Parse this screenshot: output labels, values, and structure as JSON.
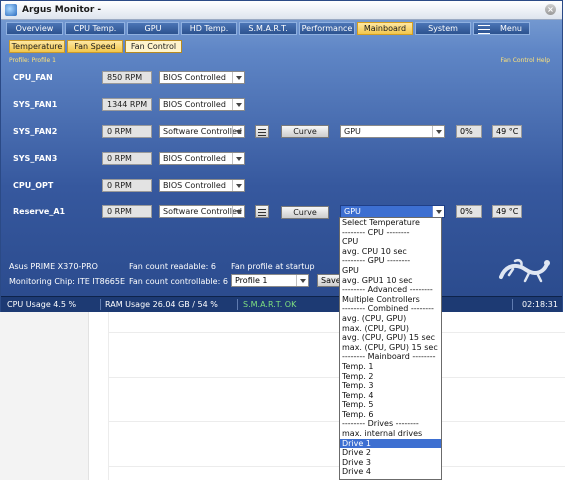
{
  "window": {
    "title": "Argus Monitor -"
  },
  "tabs": [
    {
      "label": "Overview",
      "active": false
    },
    {
      "label": "CPU Temp.",
      "active": false
    },
    {
      "label": "GPU",
      "active": false
    },
    {
      "label": "HD Temp.",
      "active": false
    },
    {
      "label": "S.M.A.R.T.",
      "active": false
    },
    {
      "label": "Performance",
      "active": false
    },
    {
      "label": "Mainboard",
      "active": true
    },
    {
      "label": "System",
      "active": false
    },
    {
      "label": "Menu",
      "active": false
    }
  ],
  "subtabs": [
    {
      "label": "Temperature",
      "active": false
    },
    {
      "label": "Fan Speed",
      "active": false
    },
    {
      "label": "Fan Control",
      "active": true
    }
  ],
  "profile_label": "Profile: Profile 1",
  "help_link": "Fan Control Help",
  "fans": [
    {
      "name": "CPU_FAN",
      "rpm": "850 RPM",
      "mode": "BIOS Controlled"
    },
    {
      "name": "SYS_FAN1",
      "rpm": "1344 RPM",
      "mode": "BIOS Controlled"
    },
    {
      "name": "SYS_FAN2",
      "rpm": "0 RPM",
      "mode": "Software Controlled",
      "curve_label": "Curve",
      "source": "GPU",
      "percent": "0%",
      "temp": "49 °C"
    },
    {
      "name": "SYS_FAN3",
      "rpm": "0 RPM",
      "mode": "BIOS Controlled"
    },
    {
      "name": "CPU_OPT",
      "rpm": "0 RPM",
      "mode": "BIOS Controlled"
    },
    {
      "name": "Reserve_A1",
      "rpm": "0 RPM",
      "mode": "Software Controlled",
      "curve_label": "Curve",
      "source": "GPU",
      "percent": "0%",
      "temp": "49 °C"
    }
  ],
  "info": {
    "board": "Asus PRIME X370-PRO",
    "chip": "Monitoring Chip: ITE IT8665E",
    "fan_readable": "Fan count readable: 6",
    "fan_controllable": "Fan count controllable: 6",
    "profile_startup": "Fan profile at startup",
    "profile_value": "Profile 1",
    "save_label": "Save"
  },
  "status": {
    "cpu": "CPU Usage 4.5 %",
    "ram": "RAM Usage 26.04 GB / 54 %",
    "smart": "S.M.A.R.T. OK",
    "time": "02:18:31"
  },
  "dropdown_options": [
    "Select Temperature",
    "-------- CPU --------",
    "CPU",
    "avg. CPU 10 sec",
    "-------- GPU --------",
    "GPU",
    "avg. GPU1 10 sec",
    "-------- Advanced --------",
    "Multiple Controllers",
    "-------- Combined --------",
    "avg. (CPU, GPU)",
    "max. (CPU, GPU)",
    "avg. (CPU, GPU) 15 sec",
    "max. (CPU, GPU) 15 sec",
    "-------- Mainboard --------",
    "Temp. 1",
    "Temp. 2",
    "Temp. 3",
    "Temp. 4",
    "Temp. 5",
    "Temp. 6",
    "-------- Drives --------",
    "max. internal drives",
    "Drive 1",
    "Drive 2",
    "Drive 3",
    "Drive 4"
  ],
  "dropdown_selected": "Drive 1",
  "colors": {
    "accent": "#f2c64c",
    "window_bg": "#36589e",
    "selection": "#3d6fd1",
    "label_yellow": "#ffe37a"
  }
}
